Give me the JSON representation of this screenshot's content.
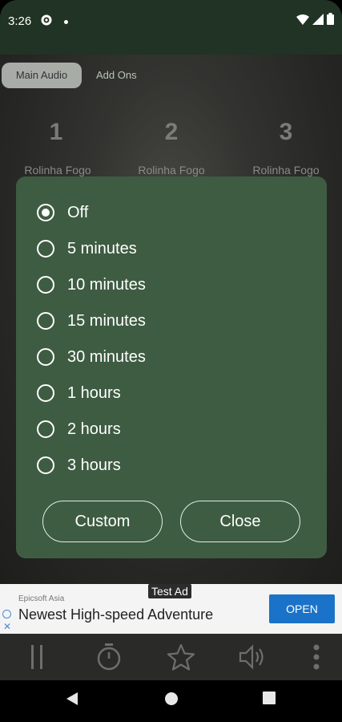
{
  "status_bar": {
    "time": "3:26",
    "icons": [
      "gear-icon",
      "wifi-icon",
      "signal-icon",
      "battery-icon"
    ]
  },
  "tabs": [
    {
      "label": "Main Audio",
      "active": true
    },
    {
      "label": "Add Ons",
      "active": false
    }
  ],
  "slots": [
    {
      "number": "1",
      "label": "Rolinha Fogo"
    },
    {
      "number": "2",
      "label": "Rolinha Fogo"
    },
    {
      "number": "3",
      "label": "Rolinha Fogo"
    }
  ],
  "timer_dialog": {
    "options": [
      {
        "label": "Off",
        "selected": true
      },
      {
        "label": "5 minutes",
        "selected": false
      },
      {
        "label": "10 minutes",
        "selected": false
      },
      {
        "label": "15 minutes",
        "selected": false
      },
      {
        "label": "30 minutes",
        "selected": false
      },
      {
        "label": "1 hours",
        "selected": false
      },
      {
        "label": "2 hours",
        "selected": false
      },
      {
        "label": "3 hours",
        "selected": false
      }
    ],
    "custom_label": "Custom",
    "close_label": "Close"
  },
  "ad": {
    "tag": "Test Ad",
    "advertiser": "Epicsoft Asia",
    "headline": "Newest High-speed Adventure",
    "cta": "OPEN"
  },
  "toolbar": {
    "icons": [
      "pause-icon",
      "timer-icon",
      "star-icon",
      "volume-icon",
      "more-vert-icon"
    ]
  },
  "nav": {
    "icons": [
      "back-icon",
      "home-icon",
      "recents-icon"
    ]
  },
  "colors": {
    "dialog_bg": "#3e5c42",
    "status_bar_bg": "#203324",
    "ad_button": "#1a73c8"
  }
}
